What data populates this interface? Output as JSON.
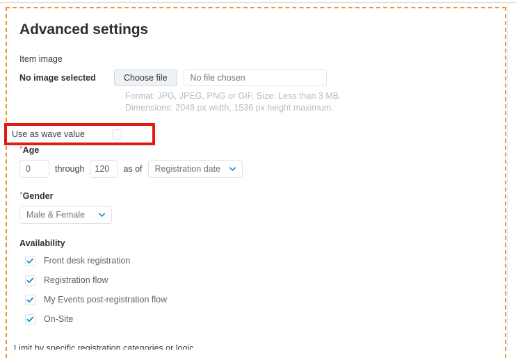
{
  "section": {
    "title": "Advanced settings"
  },
  "item_image": {
    "label": "Item image",
    "status": "No image selected",
    "choose_button": "Choose file",
    "file_input_placeholder": "No file chosen",
    "help_line_1": "Format: JPG, JPEG, PNG or GIF. Size: Less than 3 MB.",
    "help_line_2": "Dimensions: 2048 px width, 1536 px height maximum."
  },
  "wave_value": {
    "label": "Use as wave value",
    "checked": false,
    "highlight_color": "#e01b12"
  },
  "age": {
    "required_marker": "*",
    "label": "Age",
    "from_value": "0",
    "through_label": "through",
    "to_value": "120",
    "as_of_label": "as of",
    "as_of_selected": "Registration date"
  },
  "gender": {
    "required_marker": "*",
    "label": "Gender",
    "selected": "Male & Female"
  },
  "availability": {
    "label": "Availability",
    "items": [
      {
        "label": "Front desk registration",
        "checked": true
      },
      {
        "label": "Registration flow",
        "checked": true
      },
      {
        "label": "My Events post-registration flow",
        "checked": true
      },
      {
        "label": "On-Site",
        "checked": true
      }
    ]
  },
  "clipped": {
    "text": "Limit by specific registration categories or logic"
  },
  "colors": {
    "panel_dashed_border": "#f0902a",
    "accent_blue": "#1d9bd1",
    "required_star": "#e8633a",
    "heading": "#2b3038",
    "muted_text": "#b6bcc3"
  }
}
